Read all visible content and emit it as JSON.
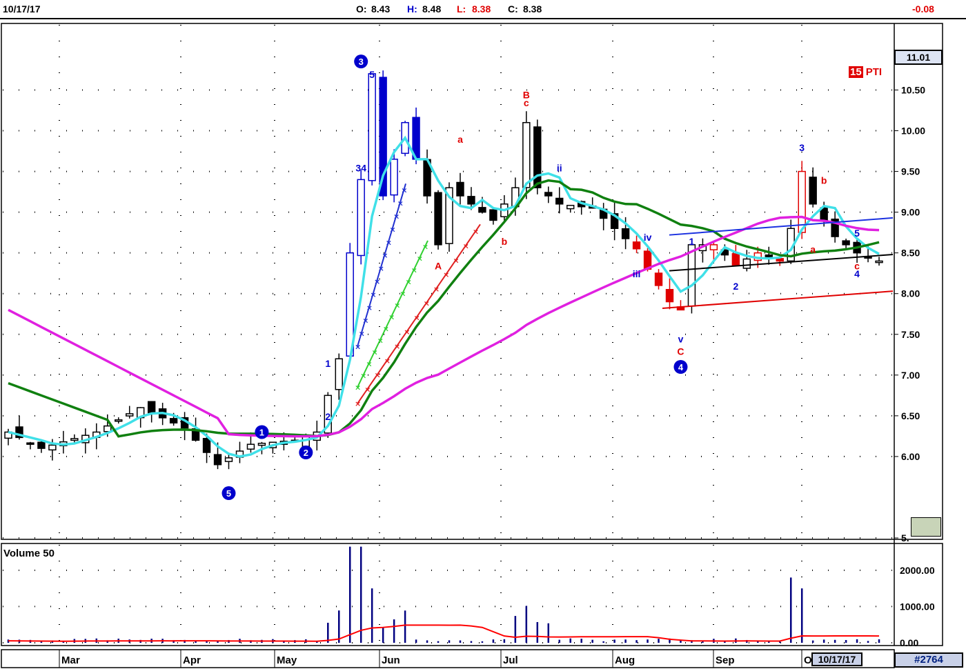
{
  "header": {
    "date": "10/17/17",
    "open_label": "O:",
    "open": "8.43",
    "high_label": "H:",
    "high": "8.48",
    "low_label": "L:",
    "low": "8.38",
    "close_label": "C:",
    "close": "8.38",
    "change": "-0.08"
  },
  "colors": {
    "up": "#ffffff",
    "down": "#000000",
    "wave_blue": "#0000cc",
    "wave_red": "#ff0000",
    "ma_fast": "#40e0e8",
    "ma_mid": "#108010",
    "ma_slow": "#e020e0",
    "vol_avg": "#ff0000",
    "vol_bar": "#000080"
  },
  "last_price": "11.01",
  "indicator": {
    "count": "15",
    "label": "PTI"
  },
  "footer": {
    "date_box": "10/17/17",
    "id": "#2764"
  },
  "chart_data": {
    "type": "candlestick",
    "y_ticks": [
      "10.50",
      "10.00",
      "9.50",
      "9.00",
      "8.50",
      "8.00",
      "7.50",
      "7.00",
      "6.50",
      "6.00",
      "5."
    ],
    "ylim": [
      5,
      11.3
    ],
    "x_ticks": [
      "Mar",
      "Apr",
      "May",
      "Jun",
      "Jul",
      "Aug",
      "Sep",
      "O"
    ],
    "volume": {
      "title": "Volume 50",
      "y_ticks": [
        "2000.00",
        "1000.00",
        "0.00"
      ]
    },
    "wave_labels": [
      {
        "text": "3",
        "circle": true,
        "at": [
          32,
          10.85
        ]
      },
      {
        "text": "5",
        "at": [
          33,
          10.65
        ]
      },
      {
        "text": "34",
        "at": [
          32,
          9.5
        ]
      },
      {
        "text": "1",
        "circle": true,
        "at": [
          23,
          6.3
        ]
      },
      {
        "text": "2",
        "circle": true,
        "at": [
          27,
          6.05
        ]
      },
      {
        "text": "5",
        "circle": true,
        "at": [
          20,
          5.55
        ]
      },
      {
        "text": "1",
        "at": [
          29,
          7.1
        ]
      },
      {
        "text": "2",
        "at": [
          29,
          6.45
        ]
      },
      {
        "text": "B",
        "red": true,
        "at": [
          47,
          10.4
        ]
      },
      {
        "text": "c",
        "red": true,
        "at": [
          47,
          10.3
        ]
      },
      {
        "text": "a",
        "red": true,
        "at": [
          41,
          9.85
        ]
      },
      {
        "text": "A",
        "red": true,
        "at": [
          39,
          8.3
        ]
      },
      {
        "text": "b",
        "red": true,
        "at": [
          45,
          8.6
        ]
      },
      {
        "text": "ii",
        "at": [
          50,
          9.5
        ]
      },
      {
        "text": "iv",
        "at": [
          58,
          8.65
        ]
      },
      {
        "text": "iii",
        "at": [
          57,
          8.2
        ]
      },
      {
        "text": "v",
        "at": [
          61,
          7.4
        ]
      },
      {
        "text": "C",
        "red": true,
        "at": [
          61,
          7.25
        ]
      },
      {
        "text": "4",
        "circle": true,
        "at": [
          61,
          7.1
        ]
      },
      {
        "text": "1",
        "at": [
          62,
          8.6
        ]
      },
      {
        "text": "2",
        "at": [
          66,
          8.05
        ]
      },
      {
        "text": "3",
        "at": [
          72,
          9.75
        ]
      },
      {
        "text": "b",
        "red": true,
        "at": [
          74,
          9.35
        ]
      },
      {
        "text": "a",
        "red": true,
        "at": [
          73,
          8.5
        ]
      },
      {
        "text": "5",
        "at": [
          77,
          8.7
        ]
      },
      {
        "text": "c",
        "red": true,
        "at": [
          77,
          8.3
        ]
      },
      {
        "text": "4",
        "at": [
          77,
          8.2
        ]
      }
    ]
  }
}
